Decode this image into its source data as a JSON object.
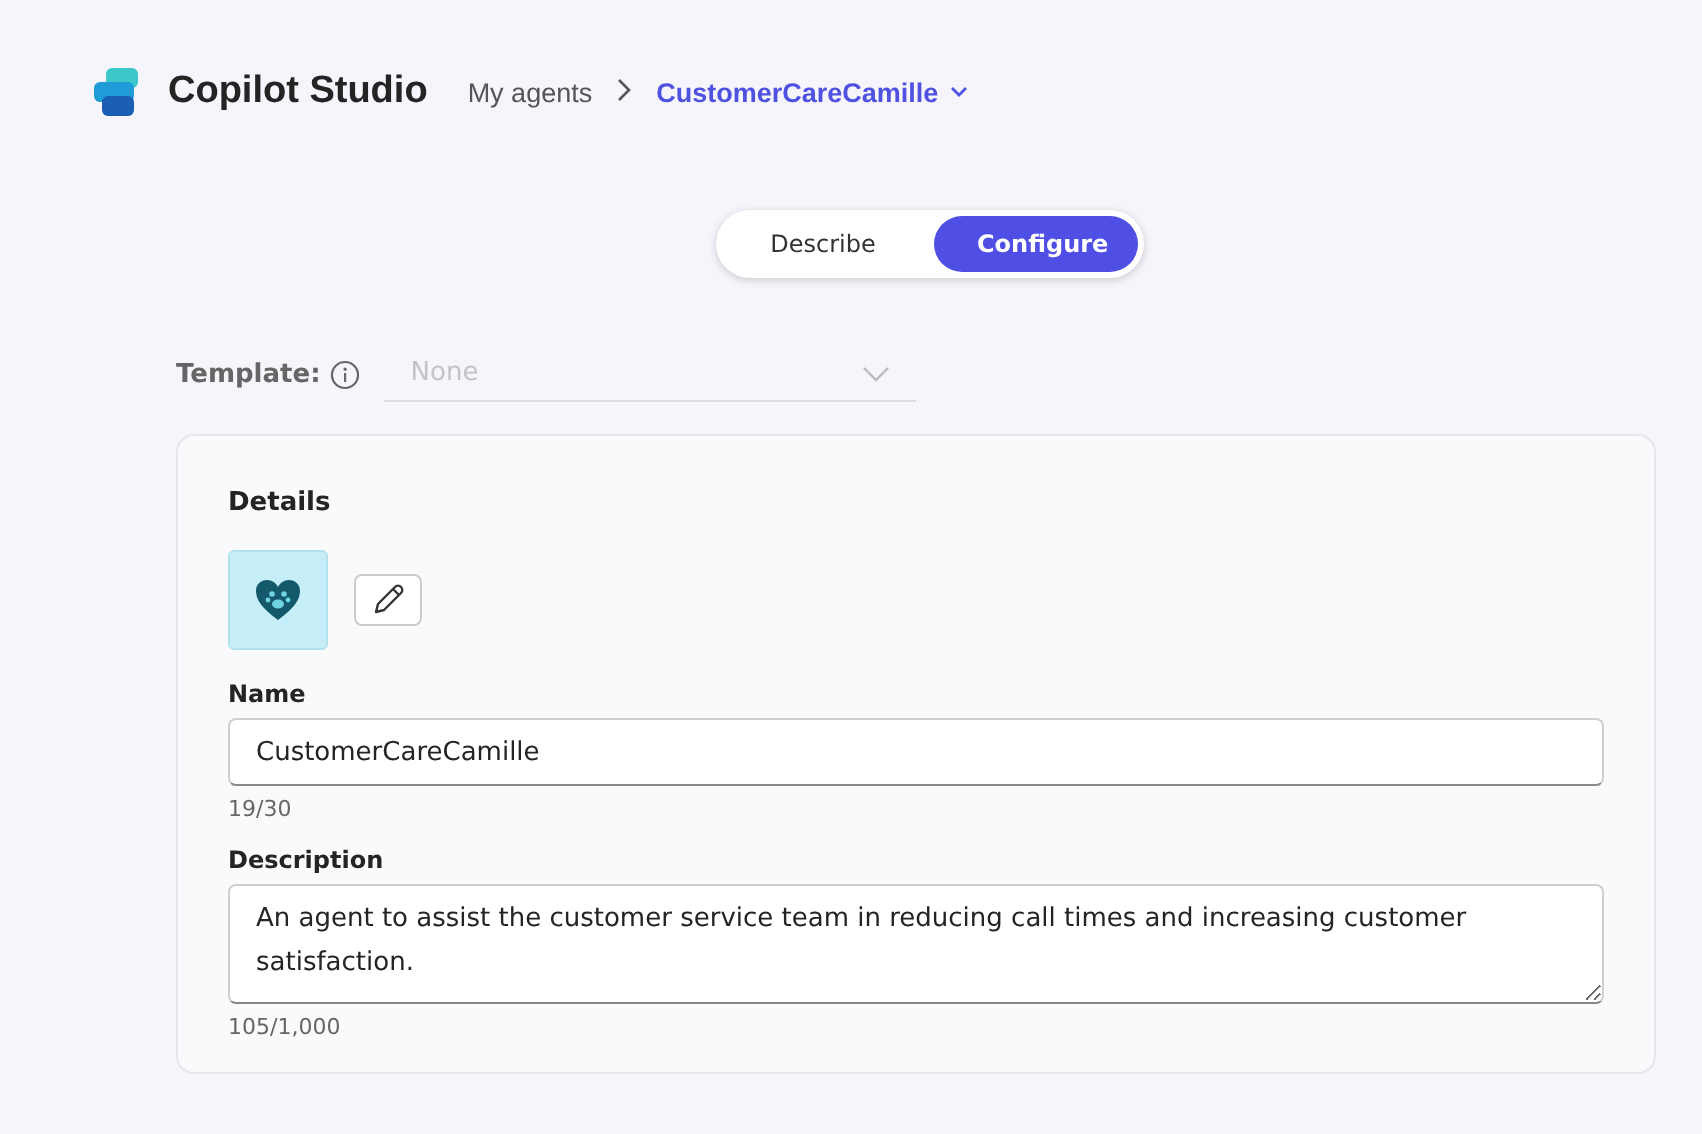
{
  "header": {
    "app_name": "Copilot Studio",
    "breadcrumb": [
      {
        "label": "My agents",
        "current": false
      },
      {
        "label": "CustomerCareCamille",
        "current": true
      }
    ]
  },
  "mode_tabs": [
    {
      "label": "Describe",
      "selected": false
    },
    {
      "label": "Configure",
      "selected": true
    }
  ],
  "template": {
    "label": "Template:",
    "value": "None",
    "disabled": true
  },
  "details": {
    "title": "Details",
    "fields": [
      {
        "kind": "input",
        "label": "Name",
        "value": "CustomerCareCamille",
        "counter": "19/30"
      },
      {
        "kind": "textarea",
        "label": "Description",
        "value": "An agent to assist the customer service team in reducing call times and increasing customer satisfaction.",
        "counter": "105/1,000"
      }
    ]
  }
}
